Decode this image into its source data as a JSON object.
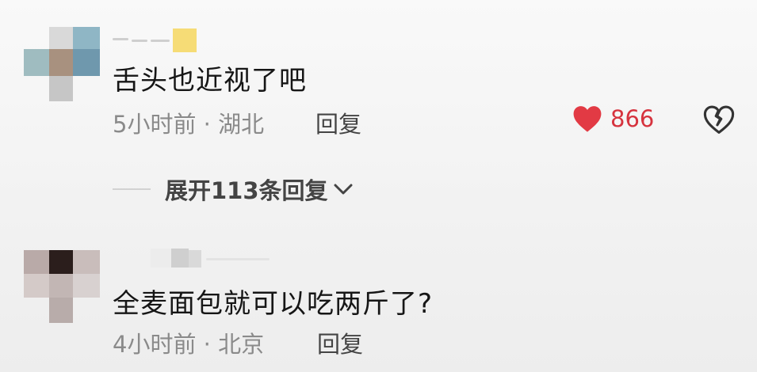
{
  "comments": [
    {
      "text": "舌头也近视了吧",
      "time": "5小时前",
      "location": "湖北",
      "reply_label": "回复",
      "like_count": "866",
      "expand_replies_label": "展开113条回复"
    },
    {
      "text": "全麦面包就可以吃两斤了?",
      "time": "4小时前",
      "location": "北京",
      "reply_label": "回复"
    }
  ],
  "meta_separator": " · ",
  "colors": {
    "like_heart": "#e23a44",
    "meta_text": "#8a8a8a",
    "reply_text": "#444444"
  },
  "icons": {
    "like": "heart-filled-icon",
    "dislike": "broken-heart-icon",
    "expand": "chevron-down-icon"
  }
}
